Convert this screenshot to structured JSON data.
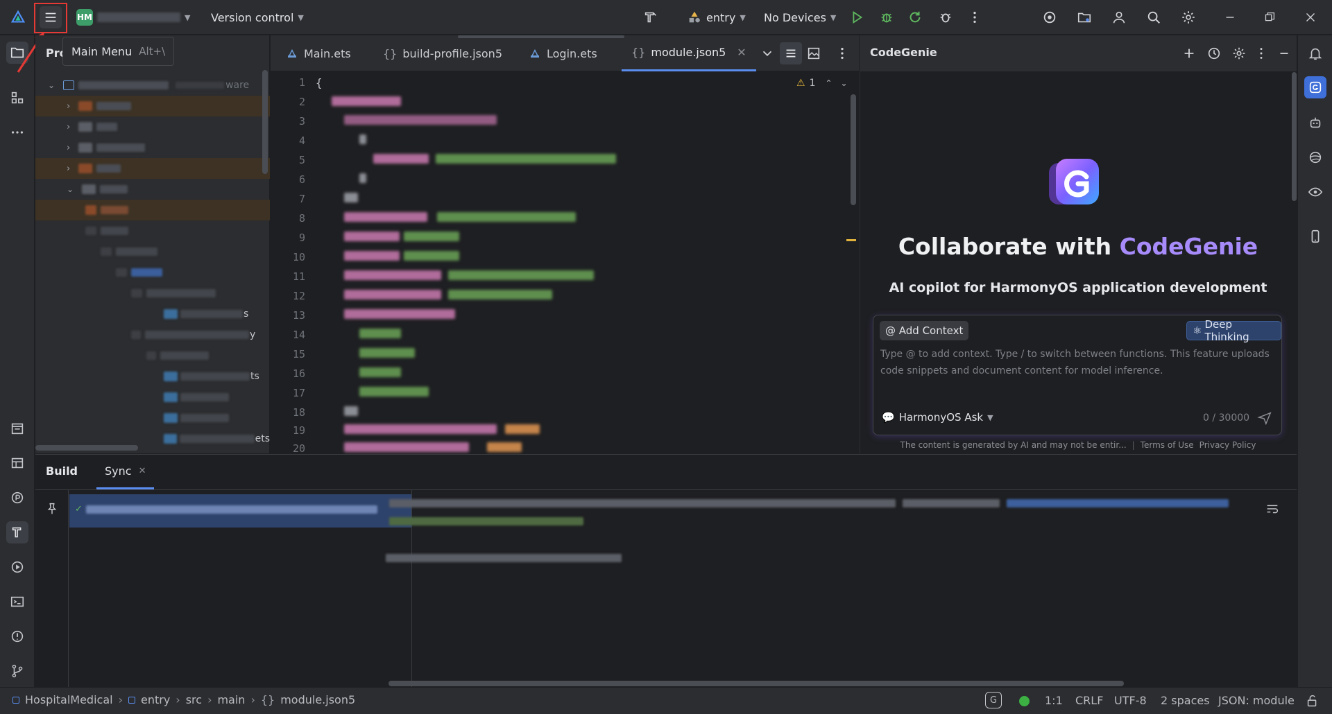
{
  "titlebar": {
    "project_badge": "HM",
    "vcs_label": "Version control",
    "run_config": "entry",
    "device": "No Devices"
  },
  "tooltip": {
    "label": "Main Menu",
    "shortcut": "Alt+\\"
  },
  "project_panel": {
    "title_fragment": "Pro"
  },
  "editor": {
    "tabs": [
      {
        "label": "Main.ets"
      },
      {
        "label": "build-profile.json5"
      },
      {
        "label": "Login.ets"
      },
      {
        "label": "module.json5"
      }
    ],
    "warning_count": "1",
    "line_numbers": [
      "1",
      "2",
      "3",
      "4",
      "5",
      "6",
      "7",
      "8",
      "9",
      "10",
      "11",
      "12",
      "13",
      "14",
      "15",
      "16",
      "17",
      "18",
      "19",
      "20"
    ],
    "first_line": "{"
  },
  "genie": {
    "title": "CodeGenie",
    "headline_prefix": "Collaborate with ",
    "headline_brand": "CodeGenie",
    "subtitle": "AI copilot for HarmonyOS application development",
    "add_context": "@ Add Context",
    "deep_thinking": "Deep Thinking",
    "placeholder": "Type @ to add context. Type / to switch between functions. This feature uploads code snippets and document content for model inference.",
    "mode": "HarmonyOS Ask",
    "counter": "0 / 30000",
    "disclaimer": "The content is generated by AI and may not be entir...",
    "terms": "Terms of Use",
    "privacy": "Privacy Policy"
  },
  "build": {
    "tab_build": "Build",
    "tab_sync": "Sync"
  },
  "status": {
    "breadcrumb": [
      "HospitalMedical",
      "entry",
      "src",
      "main",
      "module.json5"
    ],
    "position": "1:1",
    "line_sep": "CRLF",
    "encoding": "UTF-8",
    "indent": "2 spaces",
    "schema": "JSON: module"
  },
  "colors": {
    "accent": "#5b8def",
    "brand_purple": "#a78bfa",
    "highlight_red": "#e53935"
  },
  "tree_fragments": [
    "ware",
    "s",
    "y",
    "ts",
    "ets"
  ]
}
